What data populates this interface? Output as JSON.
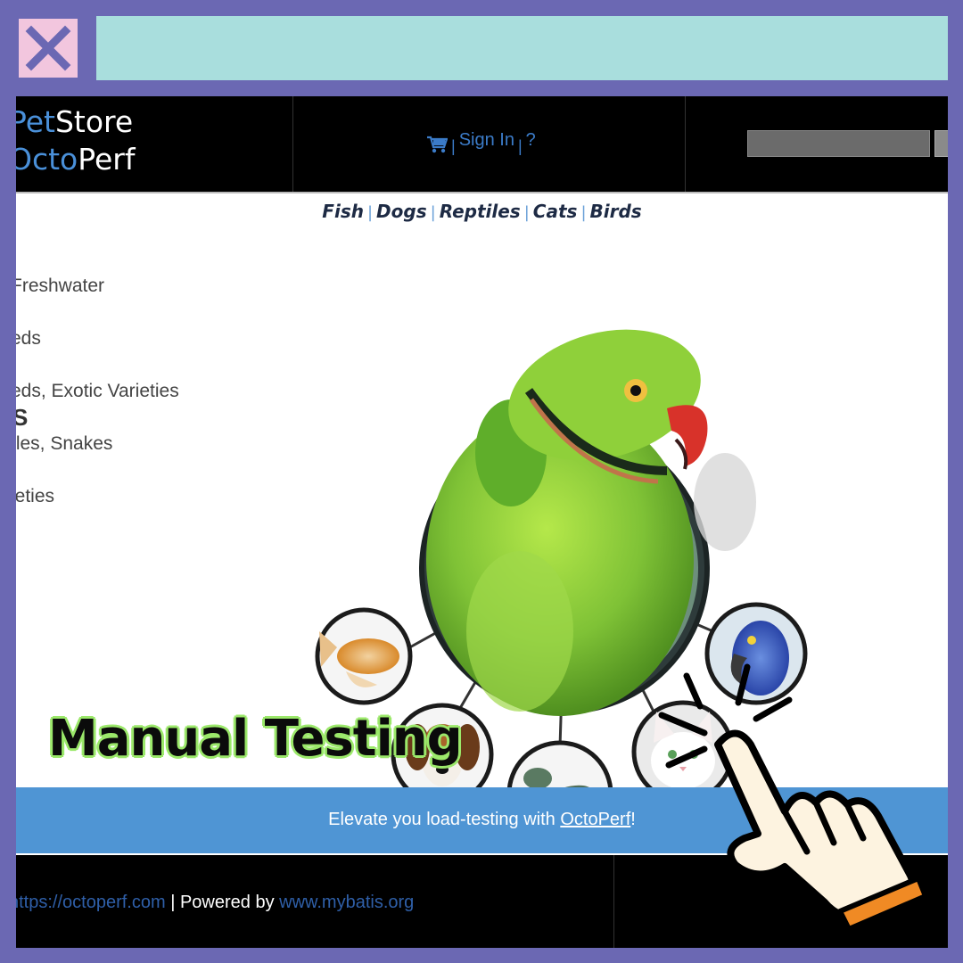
{
  "logo": {
    "line1_blue": "Pet",
    "line1_white": "Store",
    "line2_blue": "Octo",
    "line2_white": "Perf"
  },
  "header": {
    "signin": "Sign In",
    "help": "?",
    "sep": "|"
  },
  "categories": {
    "fish": "Fish",
    "dogs": "Dogs",
    "reptiles": "Reptiles",
    "cats": "Cats",
    "birds": "Birds",
    "sep": "|"
  },
  "sidebar": {
    "items": [
      "Freshwater",
      "eds",
      "eds, Exotic Varieties",
      "tles, Snakes",
      "ieties"
    ],
    "fragment": "S"
  },
  "overlay": {
    "title": "Manual Testing"
  },
  "promo": {
    "text_before": "Elevate you load-testing with ",
    "link": "OctoPerf",
    "text_after": "!"
  },
  "footer": {
    "link1": "https://octoperf.com",
    "middle": " | Powered by ",
    "link2": "www.mybatis.org"
  },
  "colors": {
    "frame": "#6b68b3",
    "address_bar": "#a9dedd",
    "close_box": "#f2c6de",
    "promo": "#4f95d4",
    "header": "#000000",
    "highlight": "#9be86a"
  },
  "icons": [
    "close-icon",
    "cart-icon",
    "pointing-hand-icon"
  ]
}
